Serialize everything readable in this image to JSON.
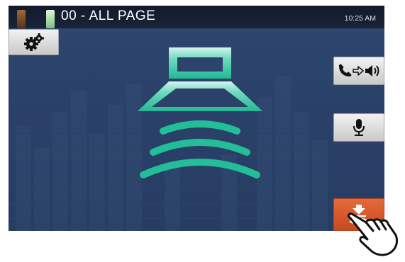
{
  "header": {
    "page_title": "00 - ALL PAGE",
    "clock": "10:25 AM"
  },
  "icons": {
    "settings": "gears-icon",
    "speaker_route": "phone-to-speaker-icon",
    "microphone": "microphone-icon",
    "end_page": "end-page-icon",
    "center": "speaker-broadcast-icon",
    "pointer": "pointing-hand-icon"
  },
  "colors": {
    "screen_bg": "#2b426b",
    "header_bg": "#151e30",
    "accent_teal": "#2bbf9a",
    "end_button": "#d9572b",
    "button_gray": "#dcdcdc"
  }
}
